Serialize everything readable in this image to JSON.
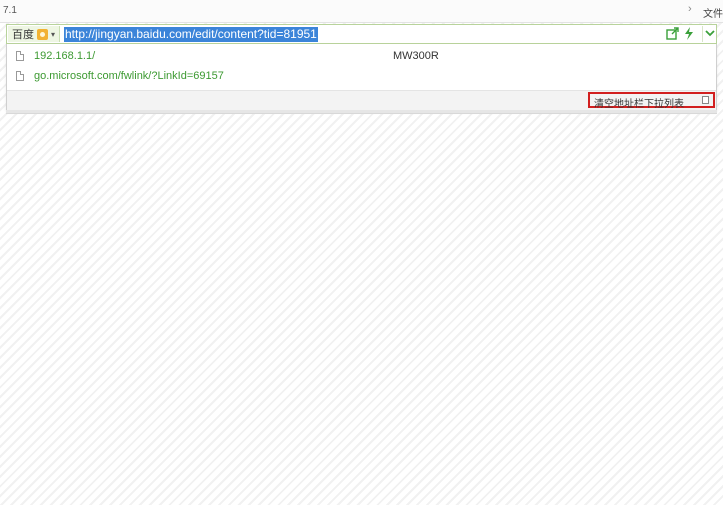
{
  "window": {
    "version_text": "7.1",
    "corner_text": "文件"
  },
  "address_bar": {
    "search_engine": "百度",
    "url": "http://jingyan.baidu.com/edit/content?tid=81951"
  },
  "dropdown": {
    "items": [
      {
        "url": "192.168.1.1/",
        "title": "MW300R"
      },
      {
        "url": "go.microsoft.com/fwlink/?LinkId=69157",
        "title": ""
      }
    ],
    "clear_label": "清空地址栏下拉列表"
  },
  "colors": {
    "url_highlight": "#3b84d9",
    "link_green": "#3d9a32",
    "highlight_box": "#d21f1f"
  }
}
